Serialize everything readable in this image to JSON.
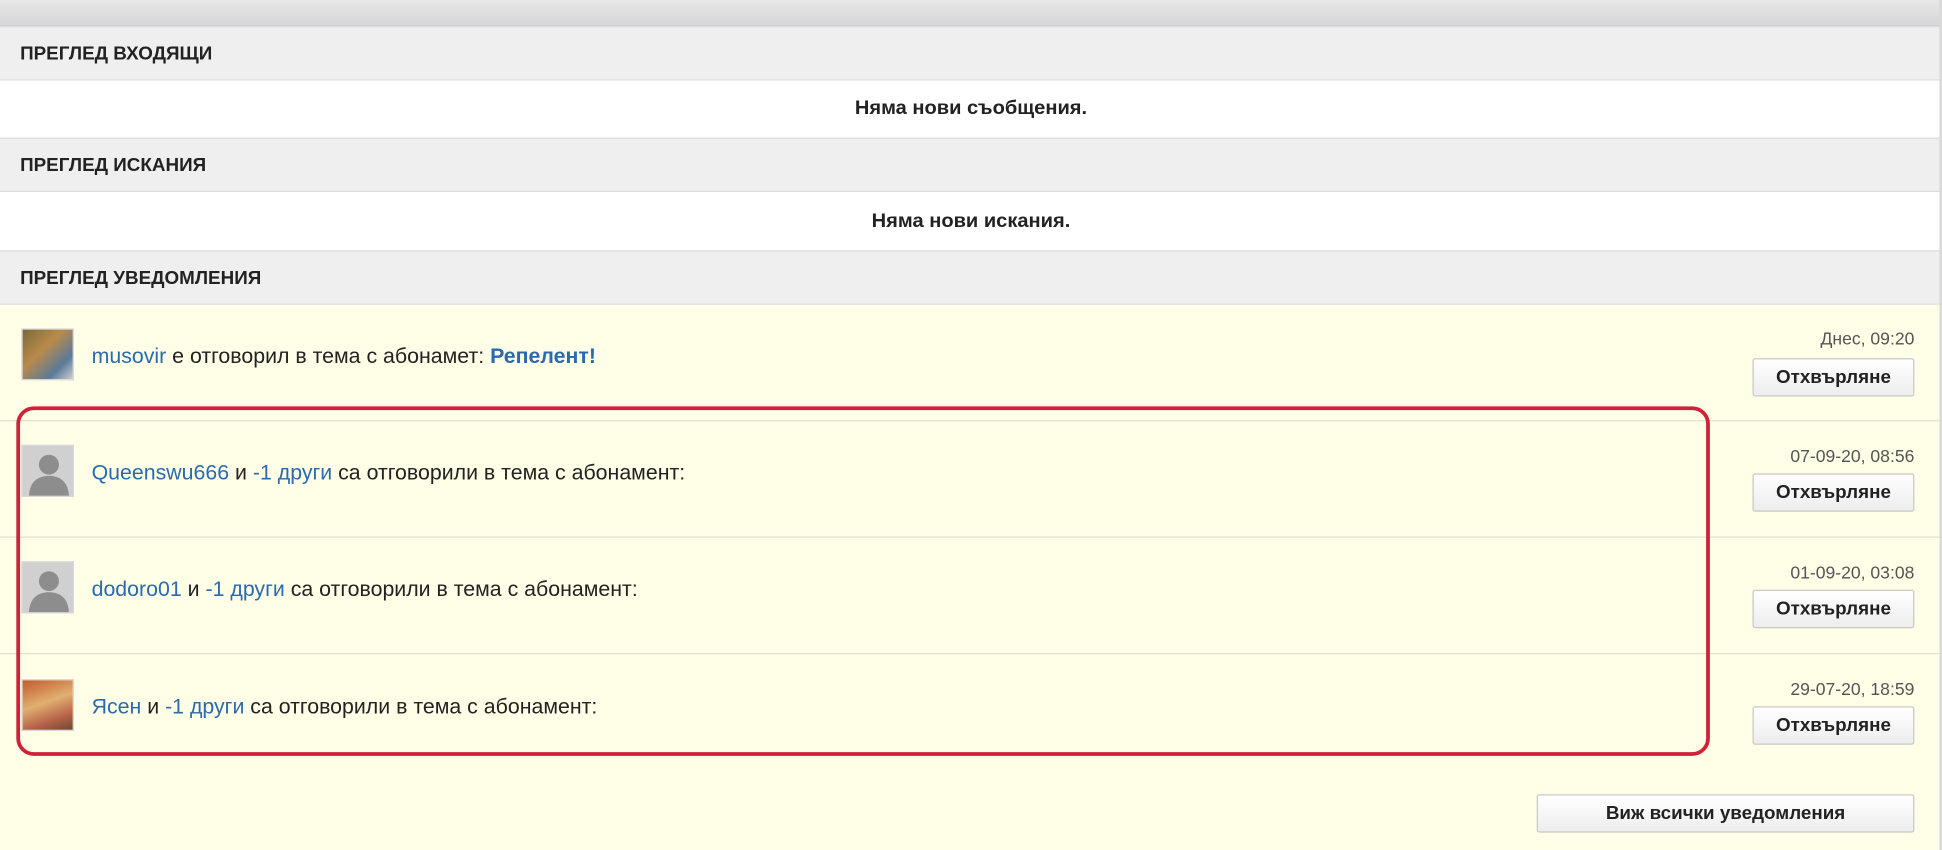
{
  "inbox": {
    "title": "ПРЕГЛЕД ВХОДЯЩИ",
    "empty_message": "Няма нови съобщения."
  },
  "requests": {
    "title": "ПРЕГЛЕД ИСКАНИЯ",
    "empty_message": "Няма нови искания."
  },
  "notifications": {
    "title": "ПРЕГЛЕД УВЕДОМЛЕНИЯ",
    "items": [
      {
        "user": "musovir",
        "text": " е отговорил в тема с абонамет: ",
        "topic": "Репелент!",
        "timestamp": "Днес, 09:20",
        "dismiss_label": "Отхвърляне"
      },
      {
        "user": "Queenswu666",
        "conj": " и ",
        "others": "-1 други",
        "text": " са отговорили в тема с абонамент:",
        "timestamp": "07-09-20, 08:56",
        "dismiss_label": "Отхвърляне"
      },
      {
        "user": "dodoro01",
        "conj": " и ",
        "others": "-1 други",
        "text": " са отговорили в тема с абонамент:",
        "timestamp": "01-09-20, 03:08",
        "dismiss_label": "Отхвърляне"
      },
      {
        "user": "Ясен",
        "conj": " и ",
        "others": "-1 други",
        "text": " са отговорили в тема с абонамент:",
        "timestamp": "29-07-20, 18:59",
        "dismiss_label": "Отхвърляне"
      }
    ],
    "view_all_label": "Виж всички уведомления"
  },
  "colors": {
    "link": "#2a6bb0",
    "notification_bg": "#fffee6",
    "highlight": "#d0213a"
  }
}
